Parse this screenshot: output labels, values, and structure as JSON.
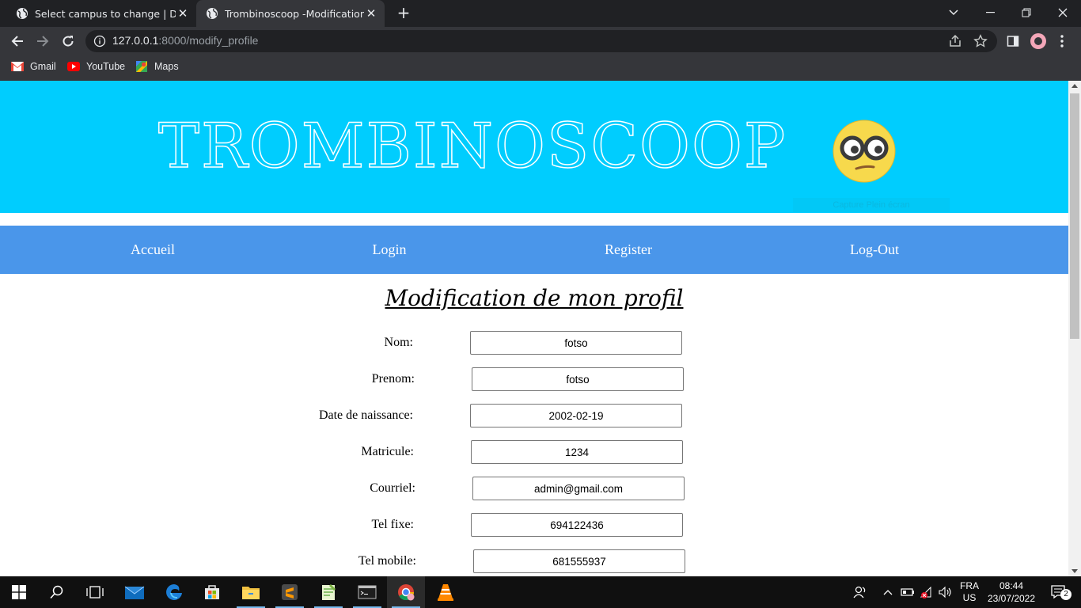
{
  "browser": {
    "tabs": [
      {
        "title": "Select campus to change | Django",
        "active": false
      },
      {
        "title": "Trombinoscoop -Modification de",
        "active": true
      }
    ],
    "url_host": "127.0.0.1",
    "url_path": ":8000/modify_profile",
    "bookmarks": [
      "Gmail",
      "YouTube",
      "Maps"
    ]
  },
  "page": {
    "site_title": "TROMBINOSCOOP",
    "emoji_icon": "nerd-face-emoji",
    "capture_tip": "Capture Plein écran",
    "nav": [
      "Accueil",
      "Login",
      "Register",
      "Log-Out"
    ],
    "form_title": "Modification de mon profil",
    "fields": [
      {
        "label": "Nom:",
        "value": "fotso"
      },
      {
        "label": "Prenom:",
        "value": "fotso"
      },
      {
        "label": "Date de naissance:",
        "value": "2002-02-19"
      },
      {
        "label": "Matricule:",
        "value": "1234"
      },
      {
        "label": "Courriel:",
        "value": "admin@gmail.com"
      },
      {
        "label": "Tel fixe:",
        "value": "694122436"
      },
      {
        "label": "Tel mobile:",
        "value": "681555937"
      }
    ]
  },
  "taskbar": {
    "lang_top": "FRA",
    "lang_bottom": "US",
    "time": "08:44",
    "date": "23/07/2022",
    "notifications": "2"
  },
  "colors": {
    "banner": "#00cdfe",
    "nav": "#4a96ea"
  }
}
